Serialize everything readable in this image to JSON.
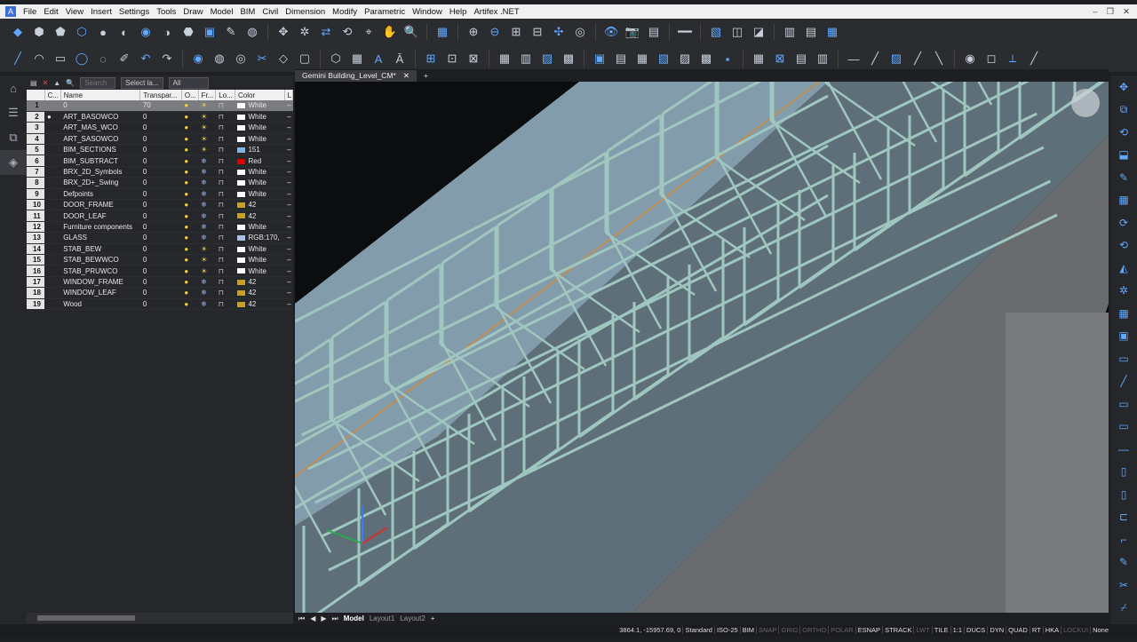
{
  "menu": [
    "File",
    "Edit",
    "View",
    "Insert",
    "Settings",
    "Tools",
    "Draw",
    "Model",
    "BIM",
    "Civil",
    "Dimension",
    "Modify",
    "Parametric",
    "Window",
    "Help",
    "Artifex .NET"
  ],
  "layers_toolbar": {
    "search_placeholder": "Search",
    "layer_filter": "Select la...",
    "filter_all": "All"
  },
  "layers_columns": [
    "C...",
    "Name",
    "Transpar...",
    "O...",
    "Fr...",
    "Lo...",
    "Color",
    "L"
  ],
  "layers": [
    {
      "n": "1",
      "name": "0",
      "tr": "70",
      "frozen": false,
      "color": "White",
      "sw": "#ffffff",
      "current": false,
      "sel": true
    },
    {
      "n": "2",
      "name": "ART_BASOWCO",
      "tr": "0",
      "frozen": false,
      "color": "White",
      "sw": "#ffffff",
      "current": true
    },
    {
      "n": "3",
      "name": "ART_MAS_WCO",
      "tr": "0",
      "frozen": false,
      "color": "White",
      "sw": "#ffffff"
    },
    {
      "n": "4",
      "name": "ART_SASOWCO",
      "tr": "0",
      "frozen": false,
      "color": "White",
      "sw": "#ffffff"
    },
    {
      "n": "5",
      "name": "BIM_SECTIONS",
      "tr": "0",
      "frozen": false,
      "color": "151",
      "sw": "#7fb8e8"
    },
    {
      "n": "6",
      "name": "BIM_SUBTRACT",
      "tr": "0",
      "frozen": true,
      "color": "Red",
      "sw": "#e00000"
    },
    {
      "n": "7",
      "name": "BRX_2D_Symbols",
      "tr": "0",
      "frozen": true,
      "color": "White",
      "sw": "#ffffff"
    },
    {
      "n": "8",
      "name": "BRX_2D+_Swing",
      "tr": "0",
      "frozen": true,
      "color": "White",
      "sw": "#ffffff"
    },
    {
      "n": "9",
      "name": "Defpoints",
      "tr": "0",
      "frozen": true,
      "color": "White",
      "sw": "#ffffff"
    },
    {
      "n": "10",
      "name": "DOOR_FRAME",
      "tr": "0",
      "frozen": true,
      "color": "42",
      "sw": "#c8a020"
    },
    {
      "n": "11",
      "name": "DOOR_LEAF",
      "tr": "0",
      "frozen": true,
      "color": "42",
      "sw": "#c8a020"
    },
    {
      "n": "12",
      "name": "Furniture components",
      "tr": "0",
      "frozen": true,
      "color": "White",
      "sw": "#ffffff"
    },
    {
      "n": "13",
      "name": "GLASS",
      "tr": "0",
      "frozen": true,
      "color": "RGB:170,",
      "sw": "#aac0e8"
    },
    {
      "n": "14",
      "name": "STAB_BEW",
      "tr": "0",
      "frozen": false,
      "color": "White",
      "sw": "#ffffff"
    },
    {
      "n": "15",
      "name": "STAB_BEWWCO",
      "tr": "0",
      "frozen": false,
      "color": "White",
      "sw": "#ffffff"
    },
    {
      "n": "16",
      "name": "STAB_PRUWCO",
      "tr": "0",
      "frozen": false,
      "color": "White",
      "sw": "#ffffff"
    },
    {
      "n": "17",
      "name": "WINDOW_FRAME",
      "tr": "0",
      "frozen": true,
      "color": "42",
      "sw": "#c8a020"
    },
    {
      "n": "18",
      "name": "WINDOW_LEAF",
      "tr": "0",
      "frozen": true,
      "color": "42",
      "sw": "#c8a020"
    },
    {
      "n": "19",
      "name": "Wood",
      "tr": "0",
      "frozen": true,
      "color": "42",
      "sw": "#c8a020"
    }
  ],
  "doc_tab": "Gemini Building_Level_CM*",
  "layout_tabs": [
    "Model",
    "Layout1",
    "Layout2"
  ],
  "status": {
    "coords": "3864.1, -15957.69, 0",
    "items": [
      {
        "t": "Standard",
        "on": true
      },
      {
        "t": "ISO-25",
        "on": true
      },
      {
        "t": "BIM",
        "on": true
      },
      {
        "t": "SNAP",
        "on": false
      },
      {
        "t": "GRID",
        "on": false
      },
      {
        "t": "ORTHO",
        "on": false
      },
      {
        "t": "POLAR",
        "on": false
      },
      {
        "t": "ESNAP",
        "on": true
      },
      {
        "t": "STRACK",
        "on": true
      },
      {
        "t": "LWT",
        "on": false
      },
      {
        "t": "TILE",
        "on": true
      },
      {
        "t": "1:1",
        "on": true
      },
      {
        "t": "DUCS",
        "on": true
      },
      {
        "t": "DYN",
        "on": true
      },
      {
        "t": "QUAD",
        "on": true
      },
      {
        "t": "RT",
        "on": true
      },
      {
        "t": "HKA",
        "on": true
      },
      {
        "t": "LOCKUI",
        "on": false
      },
      {
        "t": "None",
        "on": true
      }
    ]
  },
  "colors": {
    "rebar": "#9fc7c0",
    "beam_face": "#8aa4b4",
    "floor": "#6a6b6d"
  }
}
